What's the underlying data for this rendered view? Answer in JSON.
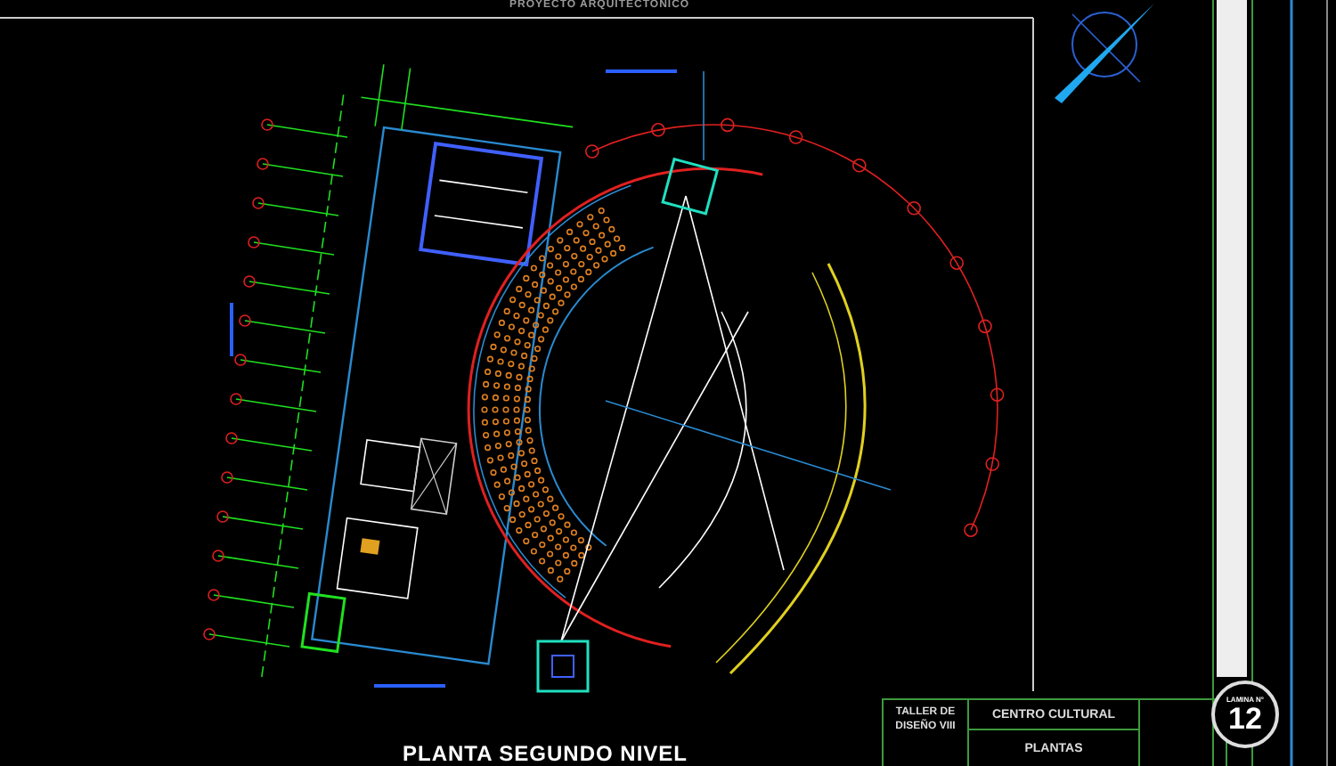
{
  "header": {
    "project": "PROYECTO ARQUITECTONICO"
  },
  "plan": {
    "title": "PLANTA SEGUNDO NIVEL"
  },
  "title_block": {
    "course": "TALLER DE DISEÑO VIII",
    "project": "CENTRO CULTURAL",
    "sheet_content": "PLANTAS",
    "sheet_label": "LAMINA N°",
    "sheet_number": "12"
  }
}
